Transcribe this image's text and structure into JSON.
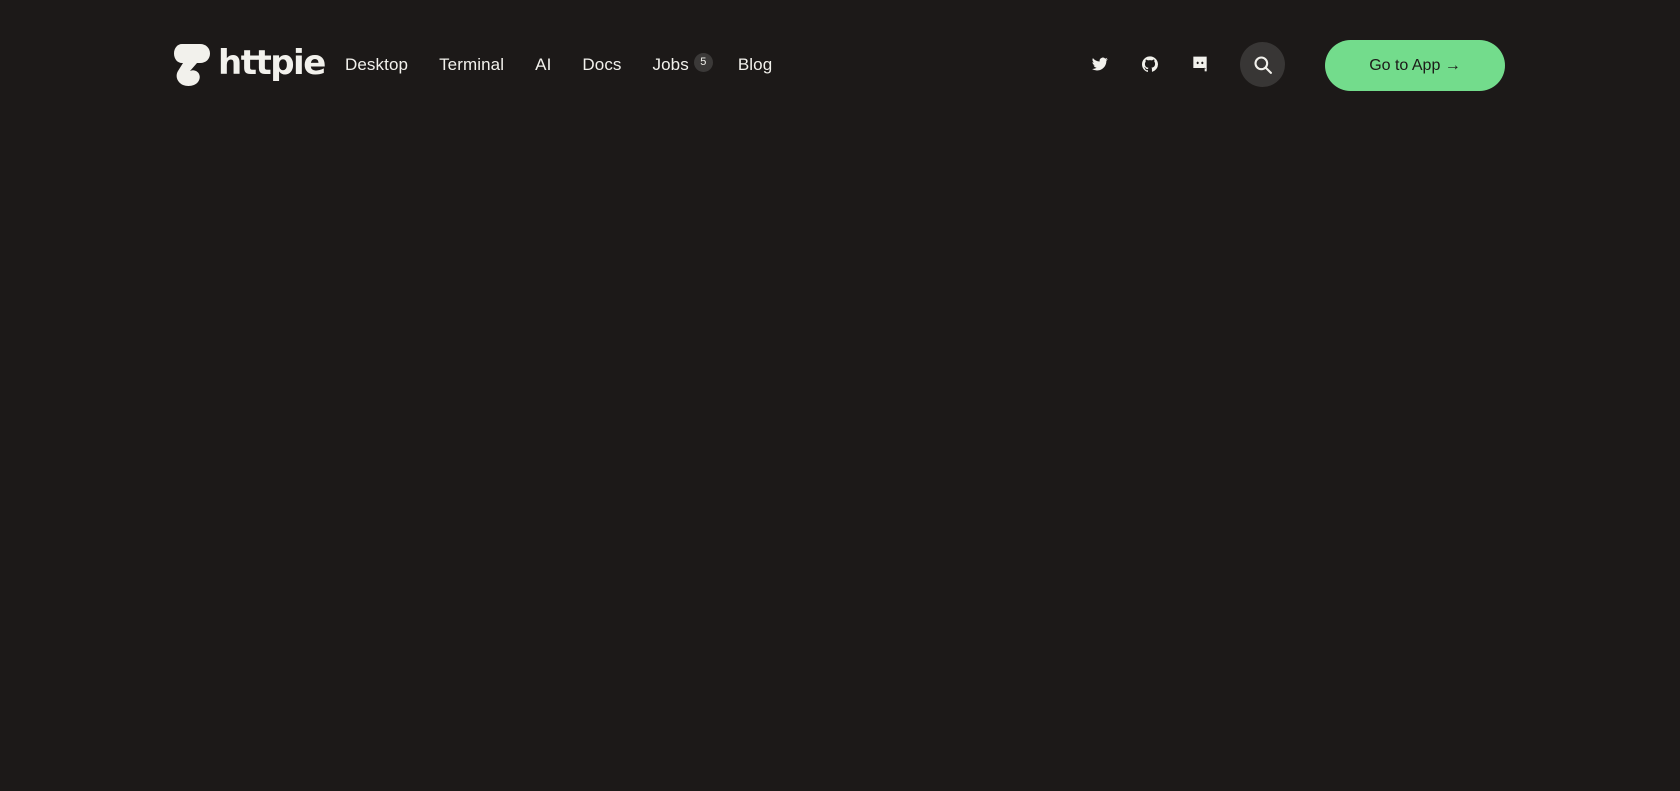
{
  "brand": {
    "name": "httpie",
    "logo_icon": "httpie-logo-mark"
  },
  "nav": {
    "items": [
      {
        "label": "Desktop"
      },
      {
        "label": "Terminal"
      },
      {
        "label": "AI"
      },
      {
        "label": "Docs"
      },
      {
        "label": "Jobs",
        "badge": "5"
      },
      {
        "label": "Blog"
      }
    ]
  },
  "social": {
    "twitter": "twitter-icon",
    "github": "github-icon",
    "discord": "discord-icon"
  },
  "search": {
    "icon": "search-icon"
  },
  "cta": {
    "label": "Go to App →"
  },
  "colors": {
    "background": "#1c1918",
    "text": "#f2f1ec",
    "accent": "#73dc8c",
    "search_bg": "#383635",
    "badge_bg": "#3b3938"
  }
}
